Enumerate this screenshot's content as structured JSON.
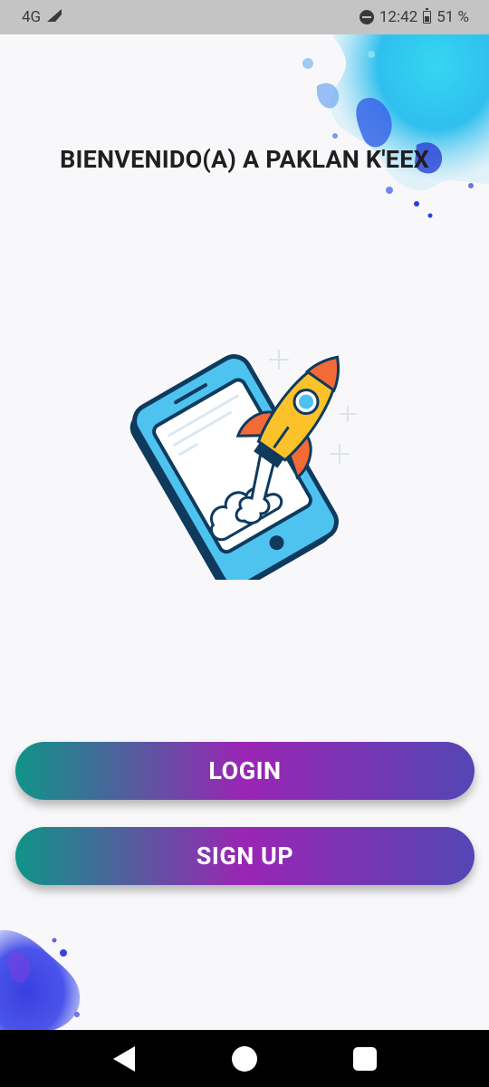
{
  "status_bar": {
    "network": "4G",
    "time": "12:42",
    "battery": "51 %",
    "icons": [
      "signal-icon",
      "do-not-disturb-icon",
      "battery-icon"
    ]
  },
  "main": {
    "title": "BIENVENIDO(A) A PAKLAN K'EEX",
    "illustration": "rocket-phone-illustration",
    "login_label": "LOGIN",
    "signup_label": "SIGN UP"
  },
  "nav_bar": {
    "icons": [
      "back-icon",
      "home-icon",
      "recents-icon"
    ]
  },
  "colors": {
    "background": "#f8f8fa",
    "button_gradient_start": "#0f9488",
    "button_gradient_mid": "#9a25b4",
    "button_gradient_end": "#5446b4",
    "status_bar": "#c4c4c4",
    "nav_bar": "#000000"
  }
}
